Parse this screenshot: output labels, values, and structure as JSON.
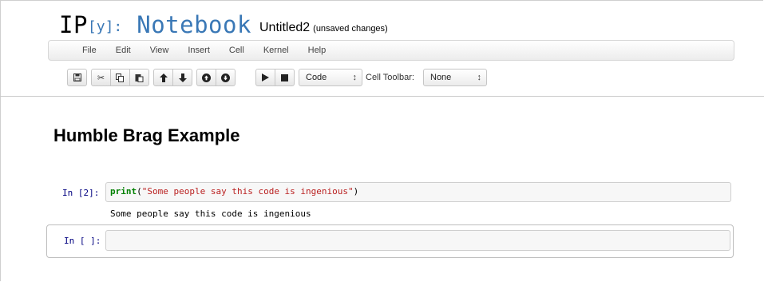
{
  "header": {
    "logo_ip": "IP",
    "logo_y": "[y]:",
    "logo_notebook": "Notebook",
    "notebook_name": "Untitled2",
    "save_status": "(unsaved changes)"
  },
  "menu": [
    "File",
    "Edit",
    "View",
    "Insert",
    "Cell",
    "Kernel",
    "Help"
  ],
  "toolbar": {
    "cell_type": "Code",
    "cell_toolbar_label": "Cell Toolbar:",
    "cell_toolbar_value": "None"
  },
  "notebook": {
    "heading": "Humble Brag Example",
    "cell1": {
      "prompt": "In [2]:",
      "code_keyword": "print",
      "code_open": "(",
      "code_string": "\"Some people say this code is ingenious\"",
      "code_close": ")",
      "output": "Some people say this code is ingenious"
    },
    "cell2": {
      "prompt": "In [ ]:",
      "code": ""
    }
  }
}
